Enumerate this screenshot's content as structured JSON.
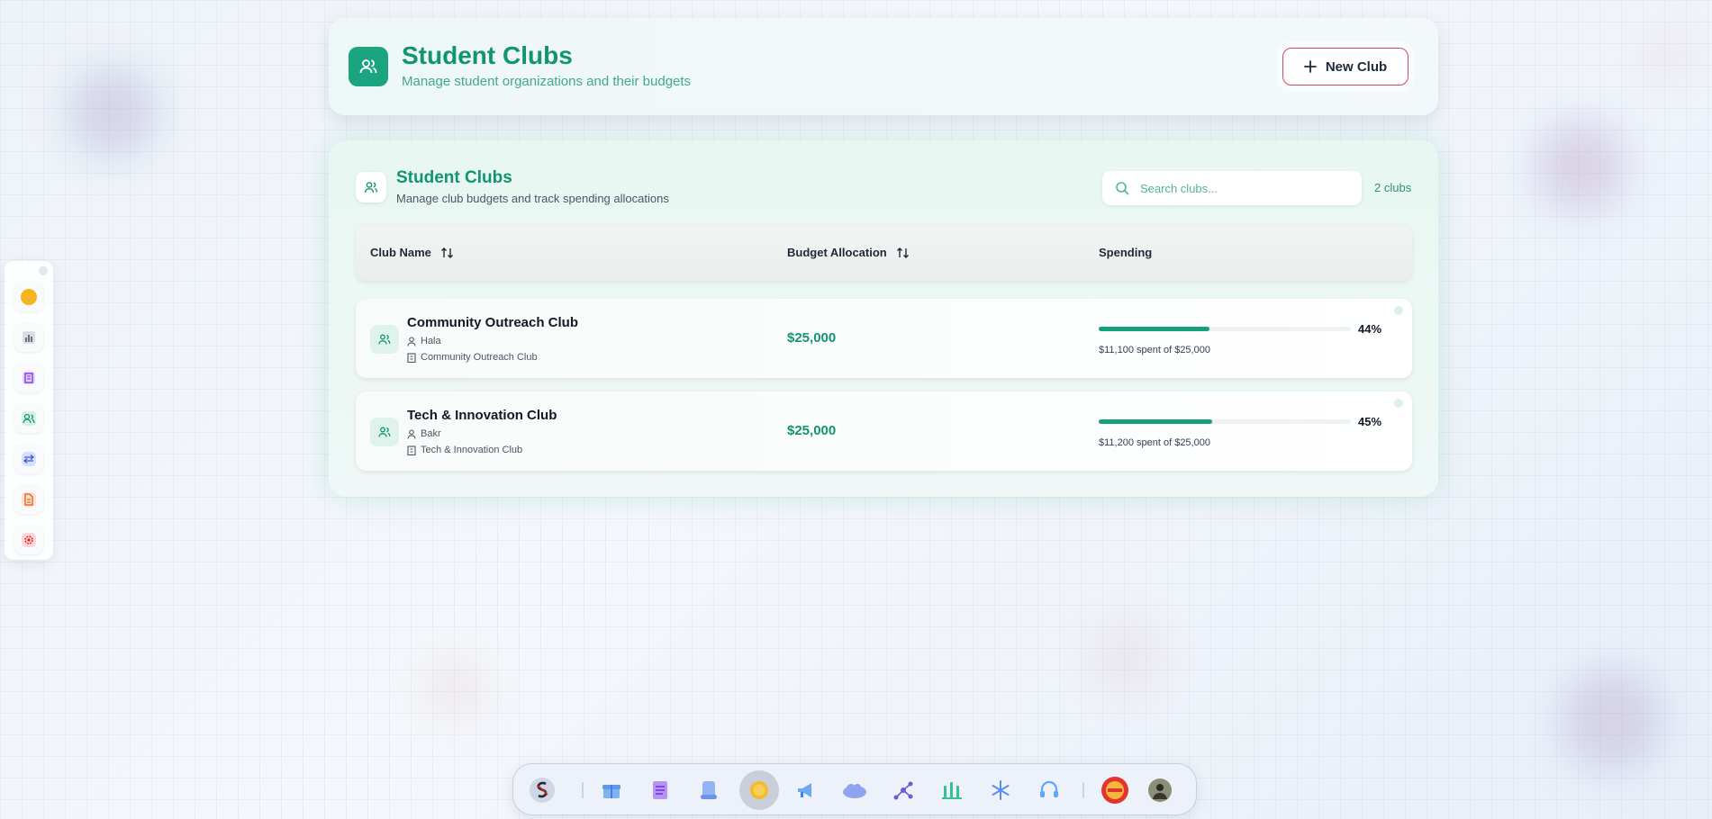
{
  "header": {
    "title": "Student Clubs",
    "subtitle": "Manage student organizations and their budgets",
    "new_button": "New Club",
    "icon": "users-icon"
  },
  "main": {
    "title": "Student Clubs",
    "subtitle": "Manage club budgets and track spending allocations",
    "search_placeholder": "Search clubs...",
    "count": "2 clubs",
    "columns": {
      "name": "Club Name",
      "budget": "Budget Allocation",
      "spending": "Spending"
    },
    "rows": [
      {
        "name": "Community Outreach Club",
        "owner": "Hala",
        "org": "Community Outreach Club",
        "budget": "$25,000",
        "percent_label": "44%",
        "percent": 44,
        "spent": "$11,100 spent of $25,000"
      },
      {
        "name": "Tech & Innovation Club",
        "owner": "Bakr",
        "org": "Tech & Innovation Club",
        "budget": "$25,000",
        "percent_label": "45%",
        "percent": 45,
        "spent": "$11,200 spent of $25,000"
      }
    ]
  },
  "sidebar": {
    "items": [
      "coin-icon",
      "bar-chart-icon",
      "building-icon",
      "users-icon",
      "transfer-icon",
      "document-icon",
      "settings-icon"
    ]
  },
  "dock": {
    "items": [
      "app-logo-icon",
      "gift-icon",
      "notes-icon",
      "scroll-icon",
      "coin-icon",
      "megaphone-icon",
      "cloud-icon",
      "network-icon",
      "bars-icon",
      "snowflake-icon",
      "headset-icon",
      "badge-icon",
      "avatar"
    ]
  },
  "colors": {
    "accent": "#139470",
    "danger_border": "#d9485f",
    "progress": "#16a07c"
  }
}
